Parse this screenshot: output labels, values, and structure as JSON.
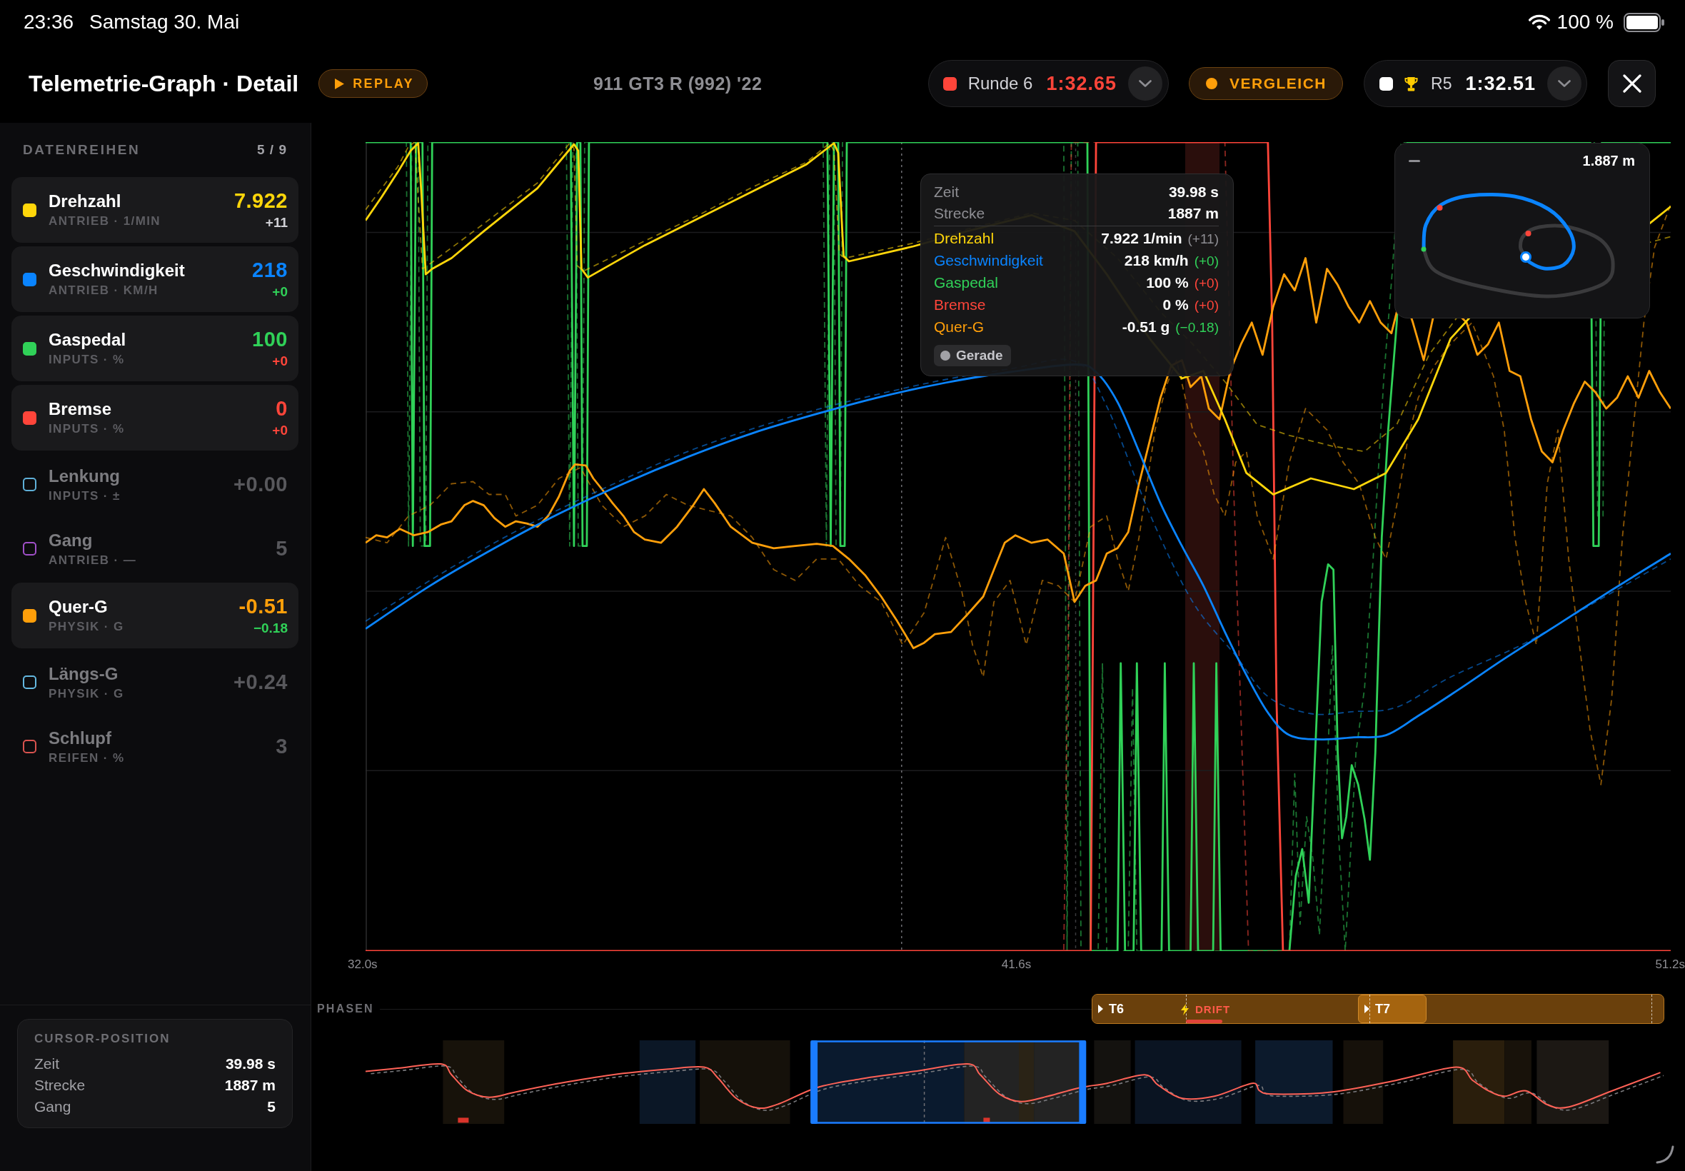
{
  "status_bar": {
    "time": "23:36",
    "date": "Samstag 30. Mai",
    "battery": "100 %"
  },
  "header": {
    "title": "Telemetrie-Graph · Detail",
    "replay_button": "REPLAY",
    "car": "911 GT3 R (992) '22",
    "lap_picker": {
      "label": "Runde 6",
      "time": "1:32.65",
      "color": "#ff453a"
    },
    "compare_toggle": {
      "label": "VERGLEICH",
      "on": true
    },
    "reference_picker": {
      "label": "R5",
      "time": "1:32.51",
      "color": "#ffffff"
    }
  },
  "sidebar": {
    "title": "DATENREIHEN",
    "count": "5 / 9",
    "series": [
      {
        "name": "Drehzahl",
        "unit": "ANTRIEB · 1/MIN",
        "value": "7.922",
        "delta": {
          "text": "+11",
          "color": "#d1d1d6"
        },
        "color": "#ffd60a",
        "on": true
      },
      {
        "name": "Geschwindigkeit",
        "unit": "ANTRIEB · KM/H",
        "value": "218",
        "delta": {
          "text": "+0",
          "color": "#30d158"
        },
        "color": "#0a84ff",
        "on": true
      },
      {
        "name": "Gaspedal",
        "unit": "INPUTS · %",
        "value": "100",
        "delta": {
          "text": "+0",
          "color": "#ff453a"
        },
        "color": "#30d158",
        "on": true
      },
      {
        "name": "Bremse",
        "unit": "INPUTS · %",
        "value": "0",
        "delta": {
          "text": "+0",
          "color": "#ff453a"
        },
        "color": "#ff453a",
        "on": true
      },
      {
        "name": "Lenkung",
        "unit": "INPUTS · ±",
        "value": "+0.00",
        "color": "#5fb0d8",
        "on": false
      },
      {
        "name": "Gang",
        "unit": "ANTRIEB · —",
        "value": "5",
        "color": "#a050c8",
        "on": false
      },
      {
        "name": "Quer-G",
        "unit": "PHYSIK · G",
        "value": "-0.51",
        "delta": {
          "text": "−0.18",
          "color": "#30d158"
        },
        "color": "#ff9f0a",
        "on": true
      },
      {
        "name": "Längs-G",
        "unit": "PHYSIK · G",
        "value": "+0.24",
        "color": "#64b8e0",
        "on": false
      },
      {
        "name": "Schlupf",
        "unit": "REIFEN · %",
        "value": "3",
        "color": "#d9534f",
        "on": false
      }
    ]
  },
  "cursor_position": {
    "title": "CURSOR-POSITION",
    "rows": [
      {
        "label": "Zeit",
        "value": "39.98 s"
      },
      {
        "label": "Strecke",
        "value": "1887 m"
      },
      {
        "label": "Gang",
        "value": "5"
      }
    ]
  },
  "chart": {
    "x_labels": [
      "32.0s",
      "41.6s",
      "51.2s"
    ],
    "tooltip": {
      "rows": [
        {
          "label": "Zeit",
          "value": "39.98 s"
        },
        {
          "label": "Strecke",
          "value": "1887 m"
        }
      ],
      "series": [
        {
          "label": "Drehzahl",
          "value": "7.922 1/min",
          "delta": {
            "text": "(+11)",
            "color": "#8e8e93"
          },
          "color": "#ffd60a"
        },
        {
          "label": "Geschwindigkeit",
          "value": "218 km/h",
          "delta": {
            "text": "(+0)",
            "color": "#30d158"
          },
          "color": "#0a84ff"
        },
        {
          "label": "Gaspedal",
          "value": "100 %",
          "delta": {
            "text": "(+0)",
            "color": "#ff453a"
          },
          "color": "#30d158"
        },
        {
          "label": "Bremse",
          "value": "0 %",
          "delta": {
            "text": "(+0)",
            "color": "#ff453a"
          },
          "color": "#ff453a"
        },
        {
          "label": "Quer-G",
          "value": "-0.51 g",
          "delta": {
            "text": "(−0.18)",
            "color": "#30d158"
          },
          "color": "#ff9f0a"
        }
      ],
      "tag": "Gerade"
    },
    "minimap": {
      "distance": "1.887 m"
    }
  },
  "phases": {
    "label": "PHASEN",
    "segments": [
      {
        "label": "T6",
        "selected": false
      },
      {
        "label": "T7",
        "selected": true
      }
    ],
    "event": "DRIFT"
  }
}
